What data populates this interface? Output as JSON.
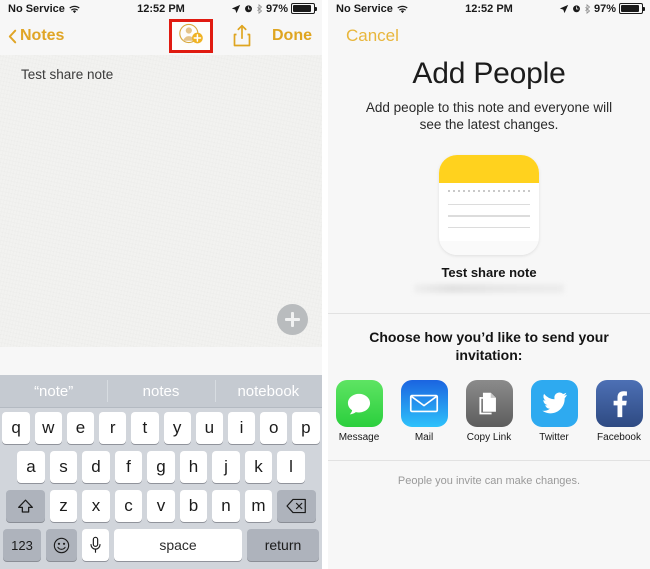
{
  "status_bar": {
    "carrier": "No Service",
    "wifi_icon": "wifi-icon",
    "time": "12:52 PM",
    "location_icon": "location-arrow-icon",
    "alarm_icon": "alarm-clock-icon",
    "bluetooth_icon": "bluetooth-icon",
    "battery_percent": "97%",
    "battery_icon": "battery-icon"
  },
  "colors": {
    "accent_gold": "#dfa520",
    "cancel_gold": "#e8b63c",
    "highlight_red": "#e01b11",
    "note_yellow": "#ffd21e",
    "message_green": "#4cd964",
    "mail_blue": "#1d9bf5",
    "copy_gray": "#6e6e6e",
    "twitter_blue": "#2eaaf0",
    "facebook_blue": "#3b5998"
  },
  "left_panel": {
    "nav": {
      "back_label": "Notes",
      "back_chevron_icon": "chevron-left-icon",
      "add_person_icon": "add-person-icon",
      "share_icon": "share-upload-icon",
      "done_label": "Done"
    },
    "note": {
      "text": "Test share note",
      "add_attachment_icon": "plus-circle-icon"
    },
    "keyboard": {
      "suggestions": [
        "“note”",
        "notes",
        "notebook"
      ],
      "row1": [
        "q",
        "w",
        "e",
        "r",
        "t",
        "y",
        "u",
        "i",
        "o",
        "p"
      ],
      "row2": [
        "a",
        "s",
        "d",
        "f",
        "g",
        "h",
        "j",
        "k",
        "l"
      ],
      "row3": [
        "z",
        "x",
        "c",
        "v",
        "b",
        "n",
        "m"
      ],
      "shift_icon": "shift-arrow-icon",
      "backspace_icon": "backspace-icon",
      "numbers_label": "123",
      "emoji_icon": "smiley-face-icon",
      "mic_icon": "microphone-icon",
      "space_label": "space",
      "return_label": "return"
    }
  },
  "right_panel": {
    "nav": {
      "cancel_label": "Cancel"
    },
    "title": "Add People",
    "subtitle": "Add people to this note and everyone will see the latest changes.",
    "note_card": {
      "icon_name": "notes-app-icon",
      "title": "Test share note",
      "preview_redacted": true
    },
    "choose_text": "Choose how you’d like to send your invitation:",
    "share_targets": [
      {
        "label": "Message",
        "icon": "message-bubble-icon"
      },
      {
        "label": "Mail",
        "icon": "envelope-icon"
      },
      {
        "label": "Copy Link",
        "icon": "copy-pages-icon"
      },
      {
        "label": "Twitter",
        "icon": "twitter-bird-icon"
      },
      {
        "label": "Facebook",
        "icon": "facebook-f-icon"
      }
    ],
    "footnote": "People you invite can make changes."
  }
}
